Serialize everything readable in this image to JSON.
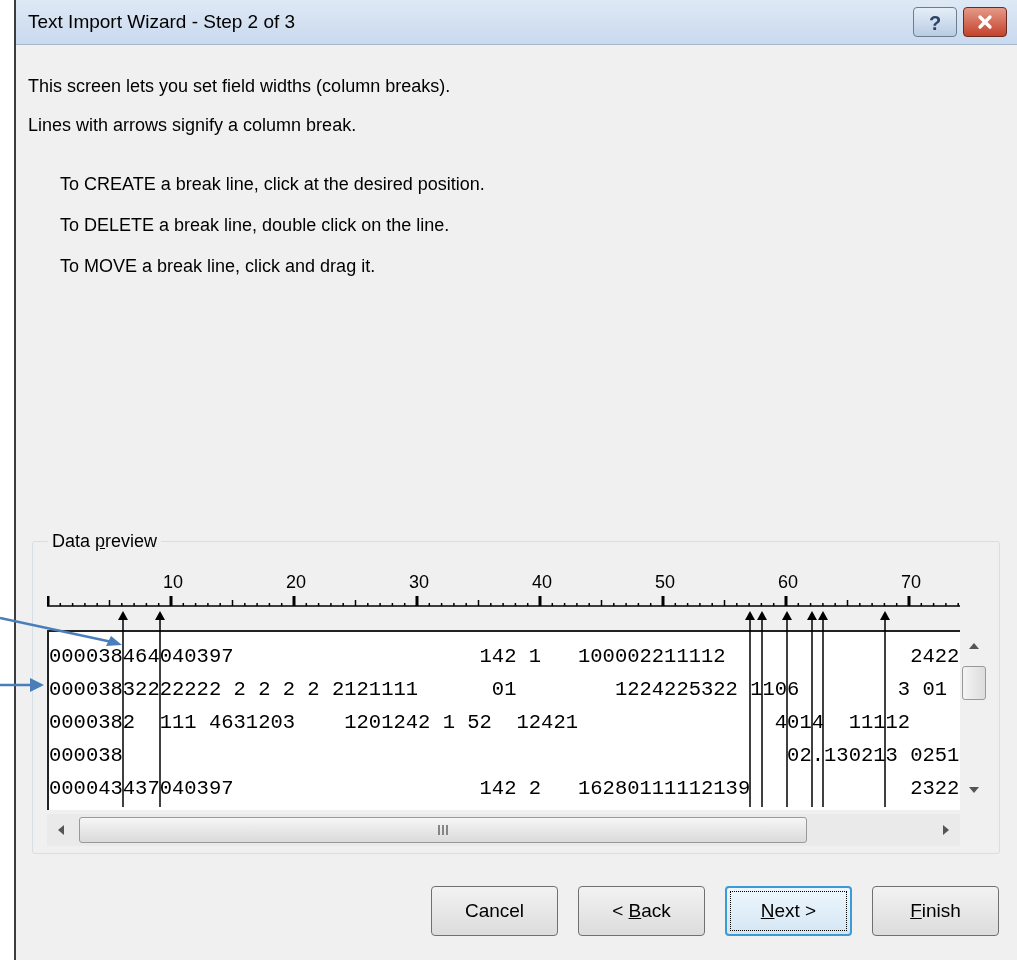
{
  "window": {
    "title": "Text Import Wizard - Step 2 of 3",
    "help_button": "?"
  },
  "intro": [
    "This screen lets you set field widths (column breaks).",
    "Lines with arrows signify a column break."
  ],
  "instructions": [
    "To CREATE a break line, click at the desired position.",
    "To DELETE a break line, double click on the line.",
    "To MOVE a break line, click and drag it."
  ],
  "data_preview": {
    "label": {
      "before": "Data ",
      "key": "p",
      "after": "review"
    },
    "ruler_labels": [
      "10",
      "20",
      "30",
      "40",
      "50",
      "60",
      "70"
    ],
    "breaks": [
      {
        "level": 0.081
      },
      {
        "level": 0.122
      },
      {
        "level": 0.77
      },
      {
        "level": 0.784
      },
      {
        "level": 0.811
      },
      {
        "level": 0.838
      },
      {
        "level": 0.851
      },
      {
        "level": 0.919
      }
    ],
    "rows": [
      "000038464040397                    142 1   100002211112               2422",
      "00003832222222 2 2 2 2 2121111      01        1224225322 1106        3 01",
      "0000382  111 4631203    1201242 1 52  12421                4014  11112",
      "000038                                                      02.130213 0251",
      "000043437040397                    142 2   16280111112139             2322"
    ]
  },
  "buttons": [
    {
      "label": {
        "before": "Cancel"
      },
      "focused": false
    },
    {
      "label": {
        "before": "< ",
        "key": "B",
        "after": "ack"
      },
      "focused": false
    },
    {
      "label": {
        "key": "N",
        "after": "ext >"
      },
      "focused": true
    },
    {
      "label": {
        "key": "F",
        "after": "inish"
      },
      "focused": false
    }
  ]
}
